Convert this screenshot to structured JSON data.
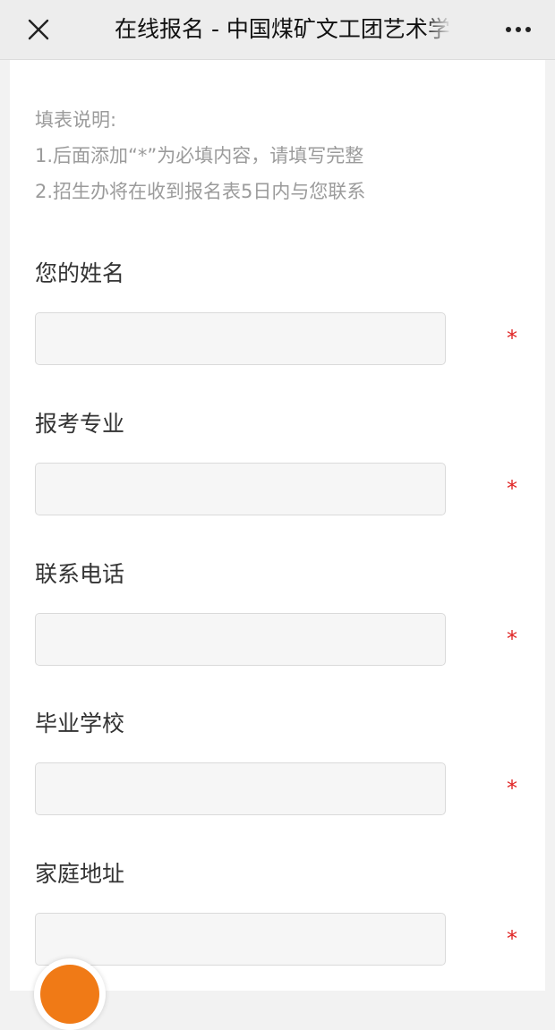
{
  "header": {
    "title": "在线报名 - 中国煤矿文工团艺术学",
    "close_icon": "close-icon",
    "more_icon": "more-horizontal-icon"
  },
  "instructions": {
    "heading": "填表说明:",
    "lines": [
      "1.后面添加“*”为必填内容，请填写完整",
      "2.招生办将在收到报名表5日内与您联系"
    ]
  },
  "form": {
    "fields": [
      {
        "label": "您的姓名",
        "value": "",
        "required_mark": "*"
      },
      {
        "label": "报考专业",
        "value": "",
        "required_mark": "*"
      },
      {
        "label": "联系电话",
        "value": "",
        "required_mark": "*"
      },
      {
        "label": "毕业学校",
        "value": "",
        "required_mark": "*"
      },
      {
        "label": "家庭地址",
        "value": "",
        "required_mark": "*"
      }
    ]
  },
  "colors": {
    "header_bg": "#ededed",
    "page_bg": "#f2f2f2",
    "required": "#e02424",
    "hint_text": "#9b9b9b",
    "fab": "#f07a16"
  }
}
